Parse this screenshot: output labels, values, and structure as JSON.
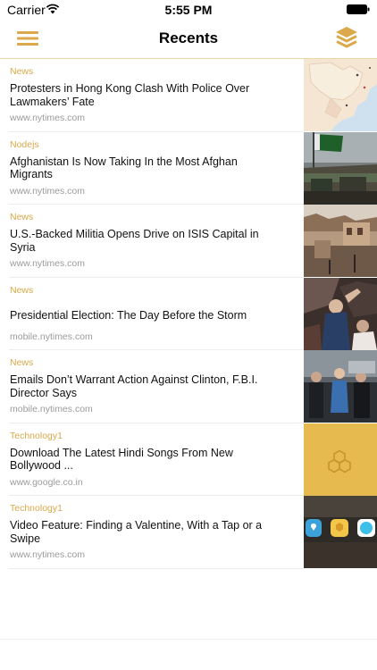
{
  "status_bar": {
    "carrier": "Carrier",
    "time": "5:55 PM",
    "icons": [
      "wifi-icon",
      "battery-icon"
    ]
  },
  "nav": {
    "title": "Recents",
    "left_icon": "hamburger-menu-icon",
    "right_icon": "layers-icon",
    "accent_color": "#dba94a"
  },
  "articles": [
    {
      "category": "News",
      "title": "Protesters in Hong Kong Clash With Police Over Lawmakers’ Fate",
      "source": "www.nytimes.com",
      "thumbnail": "map-thumbnail"
    },
    {
      "category": "Nodejs",
      "title": "Afghanistan Is Now Taking In the Most Afghan Migrants",
      "source": "www.nytimes.com",
      "thumbnail": "flag-crowd-thumbnail"
    },
    {
      "category": "News",
      "title": "U.S.-Backed Militia Opens Drive on ISIS Capital in Syria",
      "source": "www.nytimes.com",
      "thumbnail": "rooftops-thumbnail"
    },
    {
      "category": "News",
      "title": "Presidential Election: The Day Before the Storm",
      "source": "mobile.nytimes.com",
      "thumbnail": "rally-thumbnail"
    },
    {
      "category": "News",
      "title": "Emails Don’t Warrant Action Against Clinton, F.B.I. Director Says",
      "source": "mobile.nytimes.com",
      "thumbnail": "press-thumbnail"
    },
    {
      "category": "Technology1",
      "title": "Download The Latest Hindi Songs From New Bollywood ...",
      "source": "www.google.co.in",
      "thumbnail": "hexagon-placeholder-thumbnail"
    },
    {
      "category": "Technology1",
      "title": "Video Feature: Finding a Valentine, With a Tap or a Swipe",
      "source": "www.nytimes.com",
      "thumbnail": "app-icons-thumbnail"
    }
  ]
}
